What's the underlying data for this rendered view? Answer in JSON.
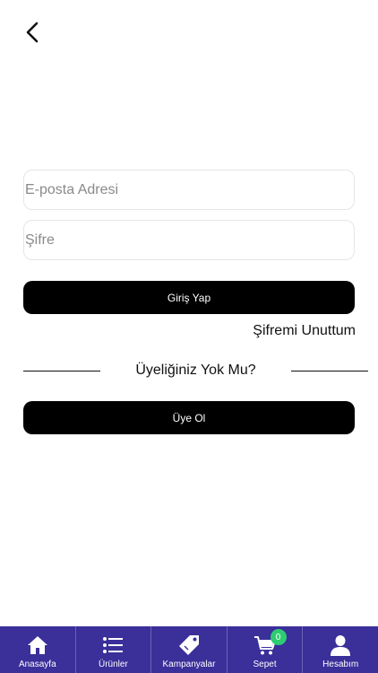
{
  "login": {
    "email_placeholder": "E-posta Adresi",
    "password_placeholder": "Şifre",
    "login_button": "Giriş Yap",
    "forgot_password": "Şifremi Unuttum",
    "no_account": "Üyeliğiniz Yok Mu?",
    "signup_button": "Üye Ol"
  },
  "tabbar": {
    "items": [
      {
        "label": "Anasayfa",
        "icon": "home-icon"
      },
      {
        "label": "Ürünler",
        "icon": "list-icon"
      },
      {
        "label": "Kampanyalar",
        "icon": "tag-icon"
      },
      {
        "label": "Sepet",
        "icon": "cart-icon",
        "badge": "0"
      },
      {
        "label": "Hesabım",
        "icon": "user-icon"
      }
    ]
  },
  "colors": {
    "tabbar_bg": "#3b2f9a",
    "button_bg": "#000000",
    "badge": "#2ecc71"
  }
}
